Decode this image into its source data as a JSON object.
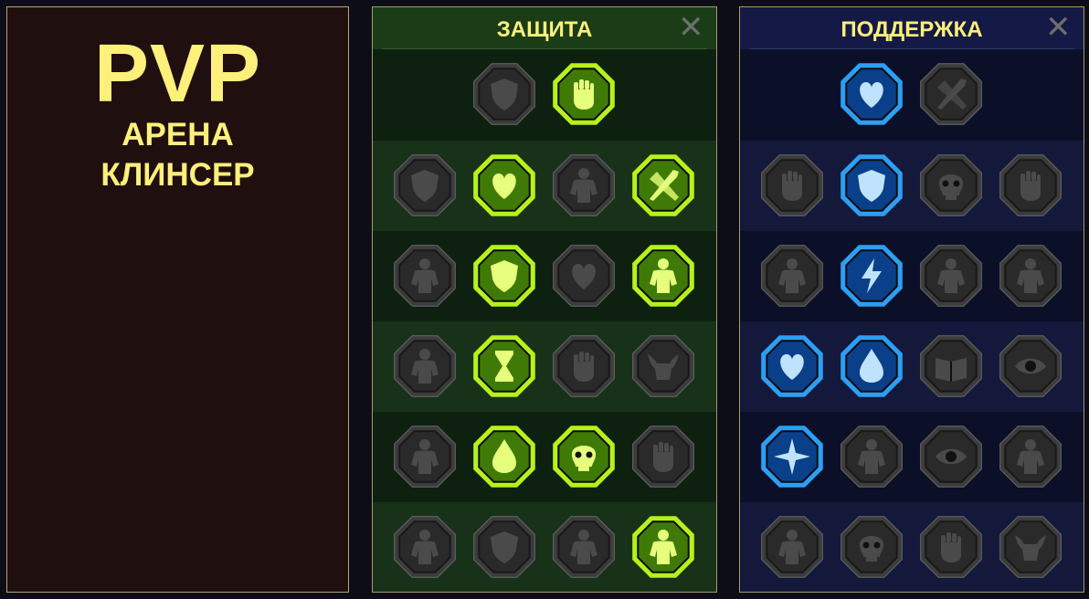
{
  "left_panel": {
    "title": "PVP",
    "line1": "АРЕНА",
    "line2": "КЛИНСЕР"
  },
  "colors": {
    "gold_text": "#fef07a",
    "green_active": "#b6f21a",
    "blue_active": "#2c9ef5",
    "inactive": "#2a2a2a"
  },
  "panels": [
    {
      "key": "defense",
      "title": "ЗАЩИТА",
      "close_label": "✕",
      "theme": "green",
      "rows": [
        [
          {
            "icon": "armor-plates-icon",
            "active": false
          },
          {
            "icon": "raised-fist-icon",
            "active": true
          }
        ],
        [
          {
            "icon": "chest-armor-icon",
            "active": false
          },
          {
            "icon": "anatomical-heart-icon",
            "active": true
          },
          {
            "icon": "stone-giant-icon",
            "active": false
          },
          {
            "icon": "crossed-blades-icon",
            "active": true
          }
        ],
        [
          {
            "icon": "two-fighters-icon",
            "active": false
          },
          {
            "icon": "knight-shield-icon",
            "active": true
          },
          {
            "icon": "skull-heart-icon",
            "active": false
          },
          {
            "icon": "hooded-hero-icon",
            "active": true
          }
        ],
        [
          {
            "icon": "crowd-cheer-icon",
            "active": false
          },
          {
            "icon": "hourglass-icon",
            "active": true
          },
          {
            "icon": "open-palm-icon",
            "active": false
          },
          {
            "icon": "bull-head-icon",
            "active": false
          }
        ],
        [
          {
            "icon": "speed-runner-icon",
            "active": false
          },
          {
            "icon": "triple-drops-icon",
            "active": true
          },
          {
            "icon": "skull-sun-icon",
            "active": true
          },
          {
            "icon": "grabbing-hand-icon",
            "active": false
          }
        ],
        [
          {
            "icon": "warrior-bust-icon",
            "active": false
          },
          {
            "icon": "winged-shield-icon",
            "active": false
          },
          {
            "icon": "bearded-face-icon",
            "active": false
          },
          {
            "icon": "flexing-strongman-icon",
            "active": true
          }
        ]
      ]
    },
    {
      "key": "support",
      "title": "ПОДДЕРЖКА",
      "close_label": "✕",
      "theme": "blue",
      "rows": [
        [
          {
            "icon": "heart-plus-icon",
            "active": true
          },
          {
            "icon": "heavy-strike-icon",
            "active": false
          }
        ],
        [
          {
            "icon": "praying-hands-icon",
            "active": false
          },
          {
            "icon": "barrier-shield-icon",
            "active": true
          },
          {
            "icon": "burning-skull-icon",
            "active": false
          },
          {
            "icon": "pointing-hand-icon",
            "active": false
          }
        ],
        [
          {
            "icon": "sparkle-figure-icon",
            "active": false
          },
          {
            "icon": "lightning-bolt-icon",
            "active": true
          },
          {
            "icon": "cracked-ground-icon",
            "active": false
          },
          {
            "icon": "shadow-clone-icon",
            "active": false
          }
        ],
        [
          {
            "icon": "chained-heart-icon",
            "active": true
          },
          {
            "icon": "fireball-icon",
            "active": true
          },
          {
            "icon": "open-book-icon",
            "active": false
          },
          {
            "icon": "angry-eyes-icon",
            "active": false
          }
        ],
        [
          {
            "icon": "compass-star-icon",
            "active": true
          },
          {
            "icon": "running-boot-icon",
            "active": false
          },
          {
            "icon": "watching-eye-icon",
            "active": false
          },
          {
            "icon": "kicking-fighter-icon",
            "active": false
          }
        ],
        [
          {
            "icon": "poison-flask-icon",
            "active": false
          },
          {
            "icon": "skull-bust-icon",
            "active": false
          },
          {
            "icon": "crushing-fist-icon",
            "active": false
          },
          {
            "icon": "eagle-head-icon",
            "active": false
          }
        ]
      ]
    }
  ]
}
